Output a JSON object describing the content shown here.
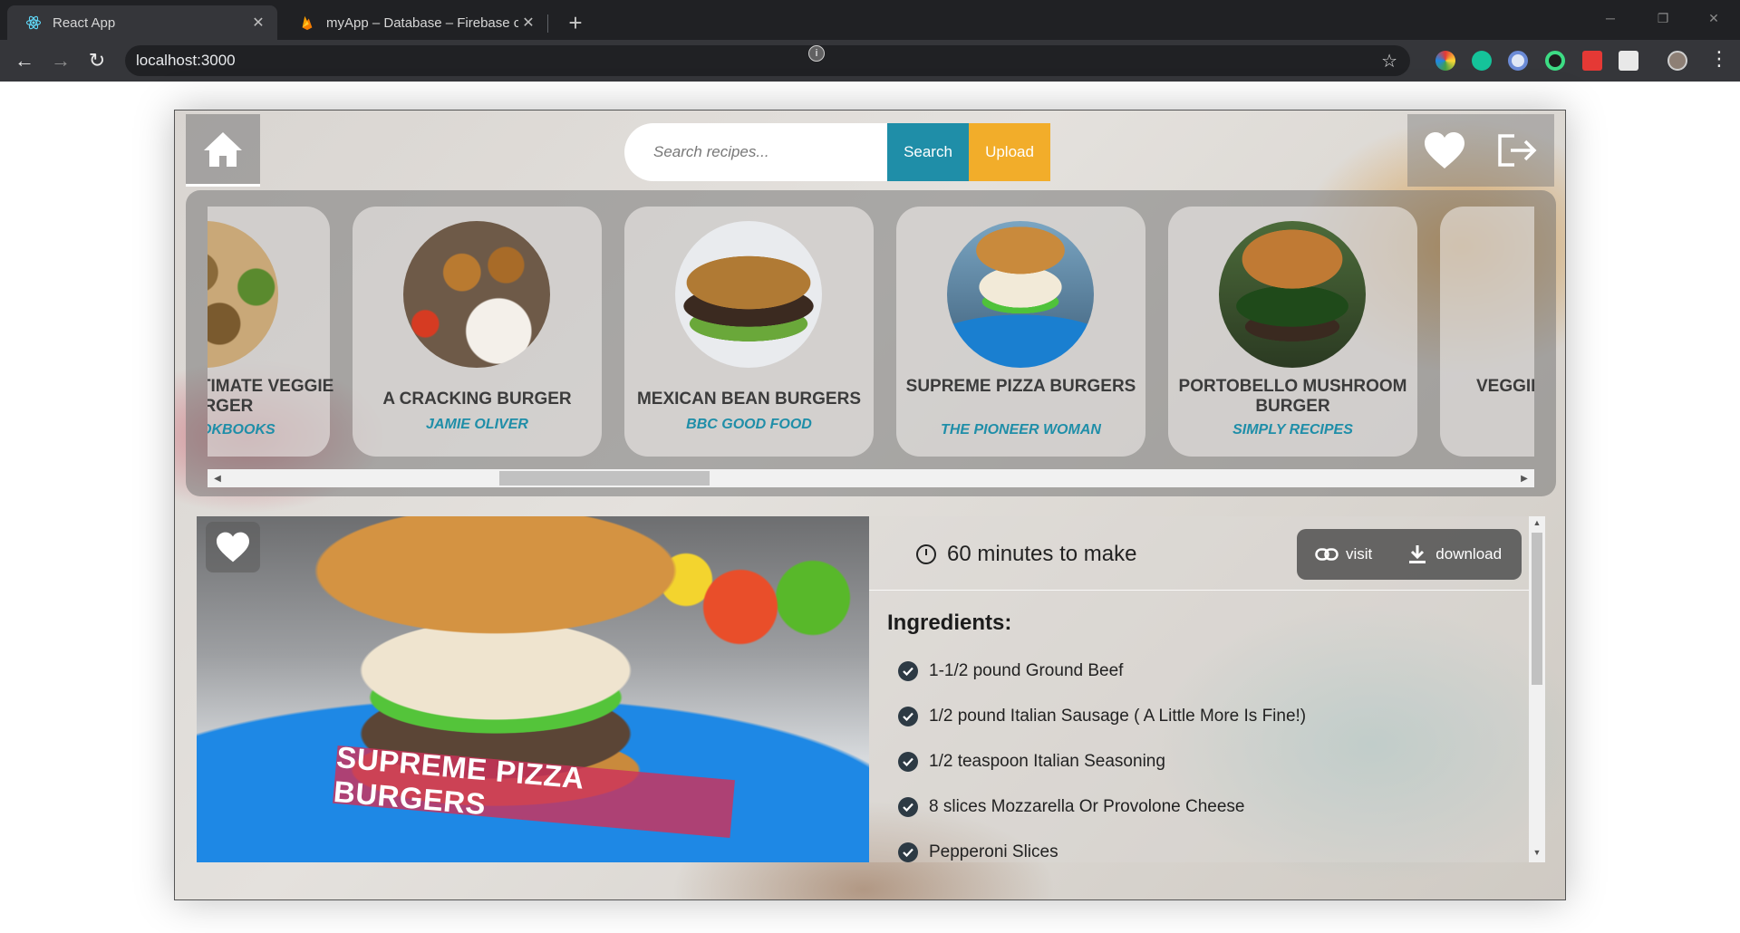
{
  "browser": {
    "tabs": [
      {
        "title": "React App",
        "active": true
      },
      {
        "title": "myApp – Database – Firebase co",
        "active": false
      }
    ],
    "url": "localhost:3000"
  },
  "header": {
    "search_placeholder": "Search recipes...",
    "search_label": "Search",
    "upload_label": "Upload"
  },
  "carousel": {
    "cards": [
      {
        "name": "ULTIMATE VEGGIE BURGER",
        "source": "COOKBOOKS"
      },
      {
        "name": "A CRACKING BURGER",
        "source": "JAMIE OLIVER"
      },
      {
        "name": "MEXICAN BEAN BURGERS",
        "source": "BBC GOOD FOOD"
      },
      {
        "name": "SUPREME PIZZA BURGERS",
        "source": "THE PIONEER WOMAN"
      },
      {
        "name": "PORTOBELLO MUSHROOM BURGER",
        "source": "SIMPLY RECIPES"
      },
      {
        "name": "VEGGIE BURGER",
        "source": ""
      }
    ]
  },
  "detail": {
    "hero_title": "SUPREME PIZZA BURGERS",
    "time": "60 minutes to make",
    "visit_label": "visit",
    "download_label": "download",
    "ingredients_title": "Ingredients:",
    "ingredients": [
      "1-1/2 pound Ground Beef",
      "1/2 pound Italian Sausage ( A Little More Is Fine!)",
      "1/2 teaspoon Italian Seasoning",
      "8 slices Mozzarella Or Provolone Cheese",
      "Pepperoni Slices"
    ]
  },
  "colors": {
    "accent_teal": "#1f8ea8",
    "accent_orange": "#f2ad2a",
    "hero_label": "#cd325a"
  }
}
